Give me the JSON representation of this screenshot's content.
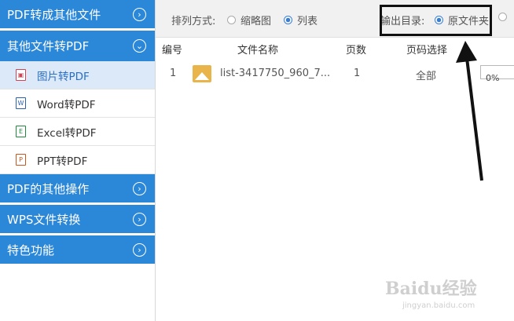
{
  "sidebar": {
    "sections": [
      {
        "label": "PDF转成其他文件",
        "icon": "chevron-right-icon"
      },
      {
        "label": "其他文件转PDF",
        "icon": "chevron-down-icon"
      },
      {
        "label": "PDF的其他操作",
        "icon": "chevron-right-icon"
      },
      {
        "label": "WPS文件转换",
        "icon": "chevron-right-icon"
      },
      {
        "label": "特色功能",
        "icon": "chevron-right-icon"
      }
    ],
    "subitems": [
      {
        "label": "图片转PDF",
        "icon": "image-file-icon",
        "active": true
      },
      {
        "label": "Word转PDF",
        "icon": "word-file-icon"
      },
      {
        "label": "Excel转PDF",
        "icon": "excel-file-icon"
      },
      {
        "label": "PPT转PDF",
        "icon": "ppt-file-icon"
      }
    ]
  },
  "toolbar": {
    "sort_label": "排列方式:",
    "sort_thumb": "缩略图",
    "sort_list": "列表",
    "output_label": "输出目录:",
    "output_original": "原文件夹"
  },
  "table": {
    "headers": [
      "编号",
      "文件名称",
      "页数",
      "页码选择"
    ],
    "rows": [
      {
        "num": "1",
        "name": "list-3417750_960_7...",
        "pages": "1",
        "range": "全部",
        "progress": "0%"
      }
    ]
  },
  "watermark": {
    "text": "Baidu经验",
    "sub": "jingyan.baidu.com"
  },
  "colors": {
    "accent": "#2b87d8",
    "active_bg": "#dbe9f8"
  }
}
